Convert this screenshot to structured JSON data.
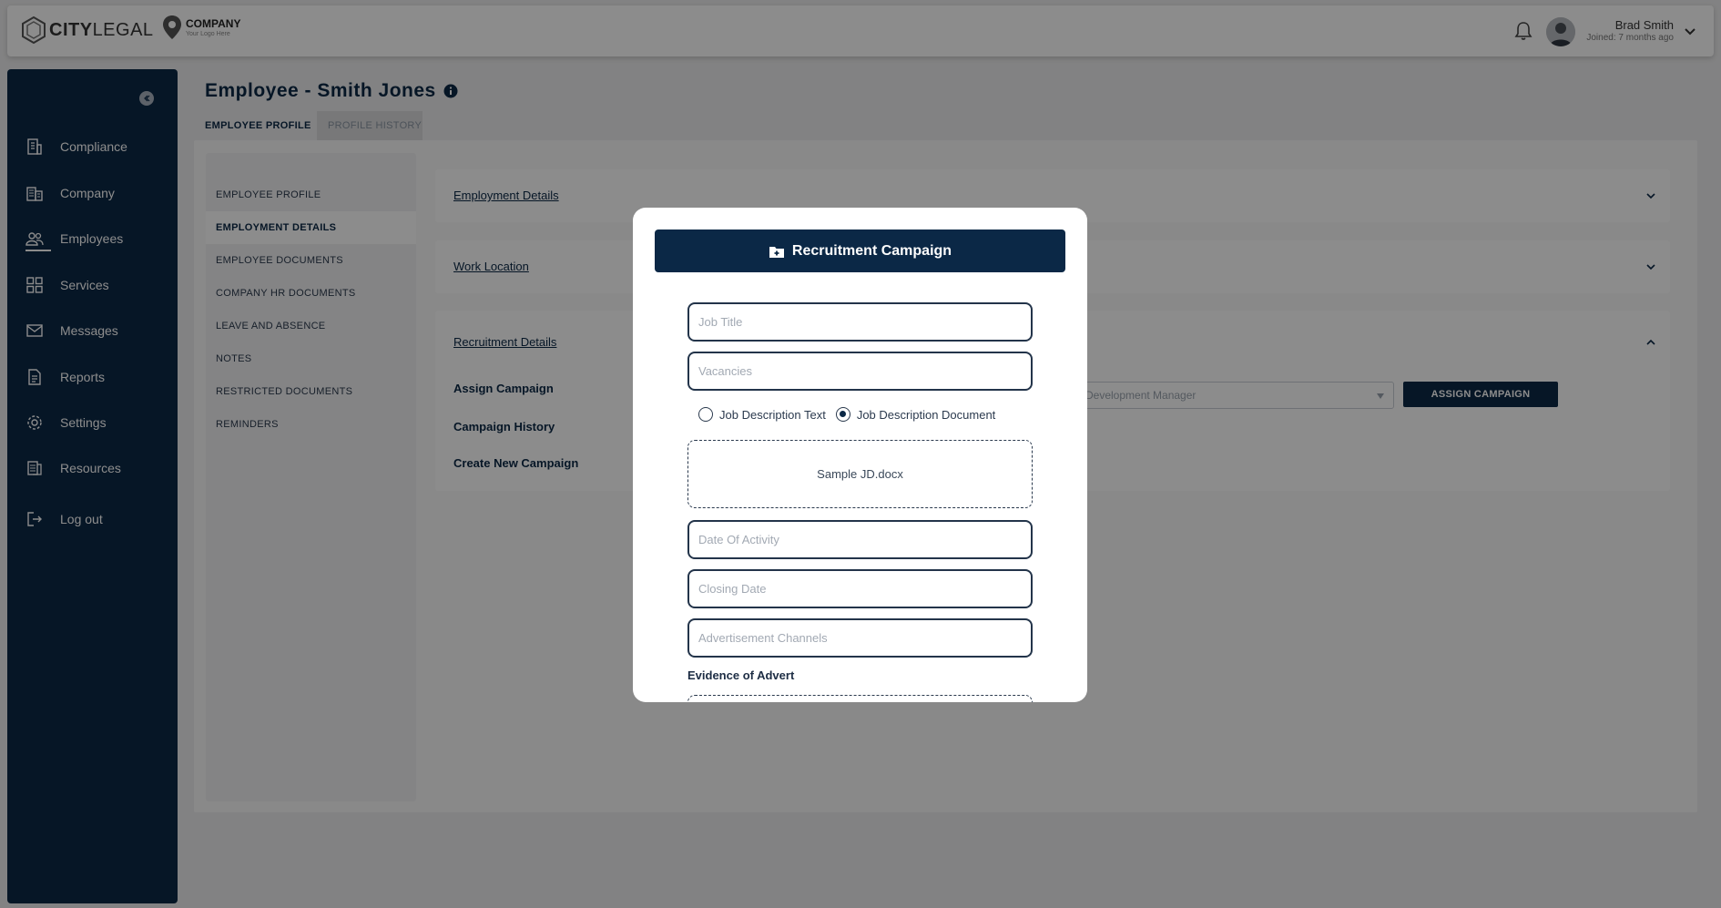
{
  "header": {
    "brand_bold": "CITY",
    "brand_light": "LEGAL",
    "company_name": "COMPANY",
    "company_tagline": "Your Logo Here",
    "user_name": "Brad Smith",
    "user_joined": "Joined: 7 months ago",
    "icons": [
      "bell-icon",
      "avatar",
      "chevron-down-icon"
    ]
  },
  "sidebar": {
    "items": [
      {
        "label": "Compliance",
        "icon": "building-icon"
      },
      {
        "label": "Company",
        "icon": "company-icon"
      },
      {
        "label": "Employees",
        "icon": "people-icon",
        "active": true
      },
      {
        "label": "Services",
        "icon": "grid-icon"
      },
      {
        "label": "Messages",
        "icon": "mail-icon"
      },
      {
        "label": "Reports",
        "icon": "report-icon"
      },
      {
        "label": "Settings",
        "icon": "gear-icon"
      },
      {
        "label": "Resources",
        "icon": "resources-icon"
      },
      {
        "label": "Log out",
        "icon": "logout-icon"
      }
    ]
  },
  "page": {
    "title": "Employee - Smith Jones",
    "tabs": [
      {
        "label": "EMPLOYEE PROFILE",
        "active": true
      },
      {
        "label": "PROFILE HISTORY",
        "active": false
      }
    ]
  },
  "subnav": {
    "items": [
      "EMPLOYEE PROFILE",
      "EMPLOYMENT DETAILS",
      "EMPLOYEE DOCUMENTS",
      "COMPANY HR DOCUMENTS",
      "LEAVE AND ABSENCE",
      "NOTES",
      "RESTRICTED DOCUMENTS",
      "REMINDERS"
    ],
    "selected": "EMPLOYMENT DETAILS"
  },
  "sections": {
    "employment": "Employment Details",
    "work_location": "Work Location",
    "recruitment": "Recruitment Details",
    "assign_campaign": "Assign Campaign",
    "campaign_history": "Campaign History",
    "create_campaign": "Create New Campaign",
    "campaign_select_value": "Development Manager",
    "assign_button": "ASSIGN CAMPAIGN"
  },
  "modal": {
    "title": "Recruitment Campaign",
    "job_title_placeholder": "Job Title",
    "vacancies_placeholder": "Vacancies",
    "radio_text": "Job Description Text",
    "radio_document": "Job Description Document",
    "radio_selected": "Job Description Document",
    "uploaded_file": "Sample JD.docx",
    "date_activity_placeholder": "Date Of Activity",
    "closing_date_placeholder": "Closing Date",
    "ad_channels_placeholder": "Advertisement Channels",
    "evidence_label": "Evidence of Advert"
  },
  "colors": {
    "navy": "#0b2846",
    "overlay": "rgba(0,0,0,0.45)",
    "white": "#ffffff"
  }
}
